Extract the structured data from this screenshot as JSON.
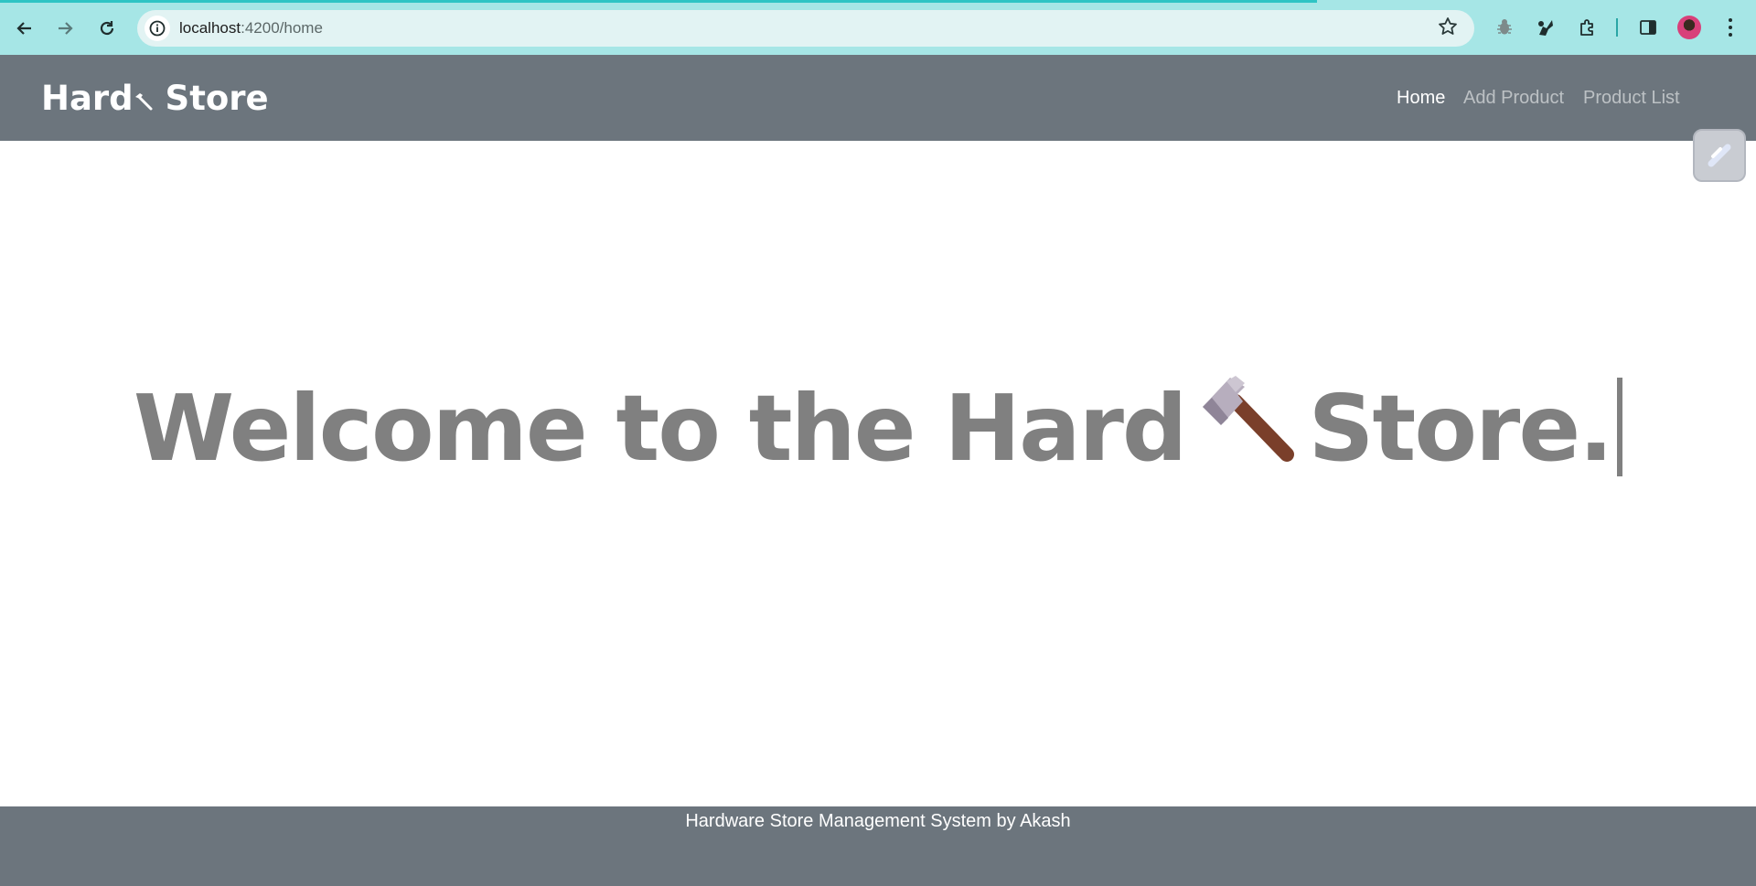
{
  "browser": {
    "url_host": "localhost",
    "url_path": ":4200/home"
  },
  "navbar": {
    "brand_prefix": "Hard",
    "brand_suffix": " Store",
    "links": [
      {
        "label": "Home",
        "active": true
      },
      {
        "label": "Add Product",
        "active": false
      },
      {
        "label": "Product List",
        "active": false
      }
    ]
  },
  "hero": {
    "title_prefix": "Welcome to the Hard",
    "title_suffix": "Store."
  },
  "footer": {
    "text": "Hardware Store Management System by Akash"
  },
  "colors": {
    "browser_bar": "#a6e6e6",
    "navbar": "#6c757d",
    "hero_text": "#808080",
    "footer": "#6c757d"
  }
}
